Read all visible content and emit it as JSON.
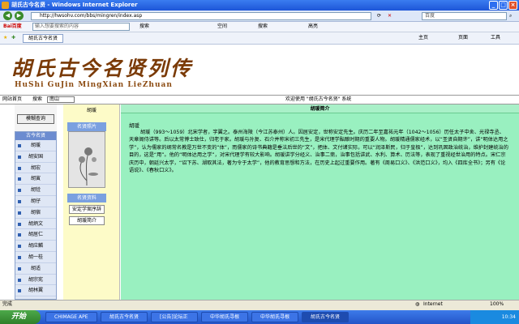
{
  "window": {
    "title": "胡氏古今名贤 - Windows Internet Explorer"
  },
  "address": {
    "url": "http://hwsohv.com/bbs/mingren/index.asp",
    "search_placeholder": "百度"
  },
  "baidu_bar": {
    "logo": "Bai百度",
    "input_placeholder": "输入想要搜索的内容",
    "search_label": "搜索",
    "space_label": "空间",
    "news_label": "搜索",
    "highlight_label": "高亮"
  },
  "fav_bar": {
    "tab_title": "胡氏古今名贤",
    "home_label": "主页",
    "page_label": "页面",
    "tools_label": "工具"
  },
  "banner": {
    "chinese": [
      "胡",
      "氏",
      "古",
      "今",
      "名",
      "贤",
      "列",
      "传"
    ],
    "pinyin": "HuShi  GuJin  MingXian  LieZhuan"
  },
  "infobar": {
    "home": "网站首页",
    "search_label": "搜索",
    "search_value": "南山",
    "welcome": "欢迎使用 \"胡氏古今名贤\" 系统"
  },
  "left": {
    "query_button": "模糊查询",
    "nav_title": "古今名贤",
    "names": [
      "胡瑗",
      "胡安国",
      "胡宏",
      "胡寅",
      "胡铨",
      "胡仔",
      "胡宿",
      "胡炳文",
      "胡居仁",
      "胡应麟",
      "胡一桂",
      "胡适",
      "胡宗宪",
      "胡林翼",
      "胡光墉"
    ]
  },
  "middle": {
    "name": "胡瑗",
    "photo_title": "名贤照片",
    "info_title": "名贤资料",
    "links": [
      "安定学案序辞",
      "胡瑗简介"
    ]
  },
  "main": {
    "heading": "胡瑗简介",
    "name": "胡瑗",
    "paragraph": "胡瑗（993～1059）北宋学者，字翼之。泰州海陵（今江苏泰州）人。因居安定，世称安定先生。庆历二年至嘉祐元年（1042～1056）历任太子中舍、光禄寺丞、天章阁侍讲等。后以太常博士致仕，归老于家。胡瑗与孙复、石介并称宋初三先生，是宋代理学酝酿时期的重要人物。胡瑗精通儒家经术，以“圣贤自期许”，讲“明体达用之学”，认为儒家的纲常名教是万世不变的“体”，而儒家的诗书典籍是垂法后世的“文”，把体、文付诸实际，可以“润泽斯民，归于皇极”，达到巩固政治统治，维护封建统治的目的，这是“用”。他的“明体达用之学”，对宋代理学有较大影响。胡瑗讲学分经义、治事二斋，治事包括讲武、水利、算术、历法等，表现了重视经世治用的特点。宋仁宗庆历中，朝廷兴太学，“诏下苏、湖取其法，著为令于太学”，他的教育思想和方法，在历史上起过重要作用。著有《周易口义》、《洪范口义》，均入《四库全书》；另有《论语说》、《春秋口义》。"
  },
  "status": {
    "left": "完成",
    "zone": "Internet",
    "zoom": "100%"
  },
  "taskbar": {
    "start": "开始",
    "tasks": [
      "CHIMAGE APE",
      "胡氏古今名贤",
      "[公告]论坛正",
      "中华胡氏寻根",
      "中华胡氏寻根",
      "胡氏古今名贤"
    ],
    "clock": "10:34"
  },
  "colors": {
    "title_blue": "#1d55d8",
    "main_bg": "#99f0c0",
    "mid_bg": "#fdfbc8",
    "banner_text": "#7a3a06"
  }
}
